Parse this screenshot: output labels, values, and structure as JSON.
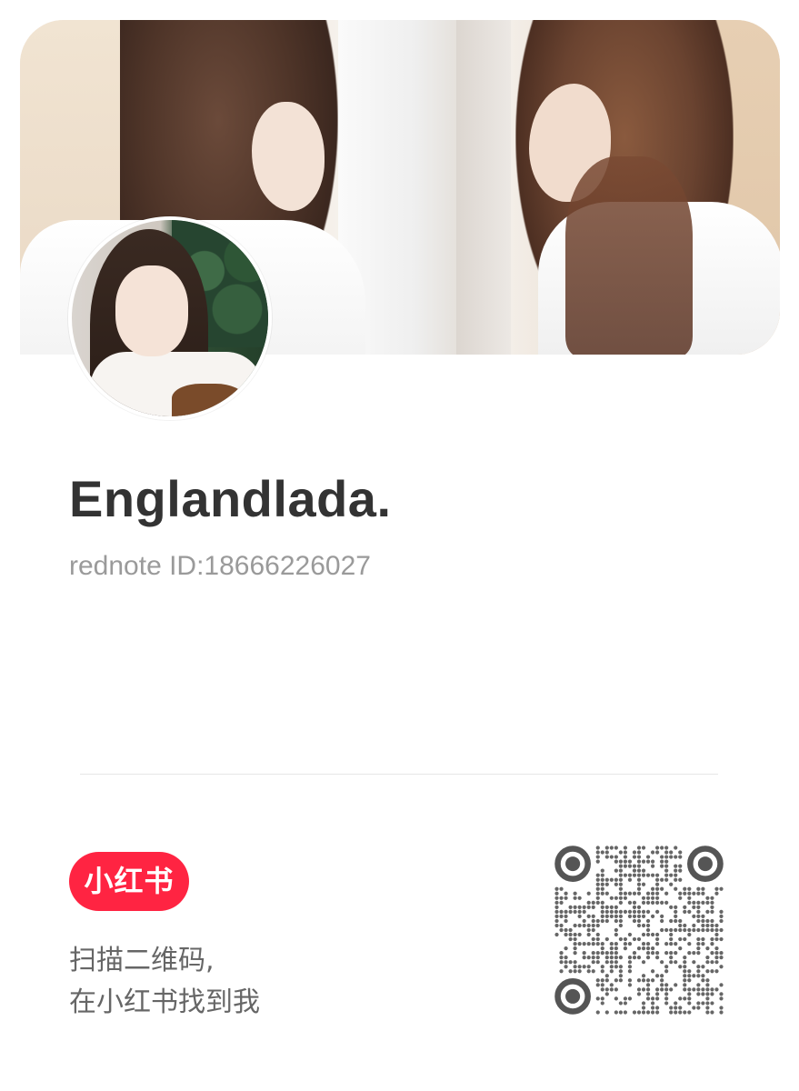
{
  "profile": {
    "name": "Englandlada.",
    "id_line": "rednote ID:18666226027"
  },
  "brand": {
    "logo_text": "小红书",
    "accent_color": "#ff2442"
  },
  "footer": {
    "line1": "扫描二维码,",
    "line2": "在小红书找到我"
  },
  "icons": {
    "qr": "qr-code-icon",
    "avatar": "avatar",
    "banner": "banner-photo"
  }
}
